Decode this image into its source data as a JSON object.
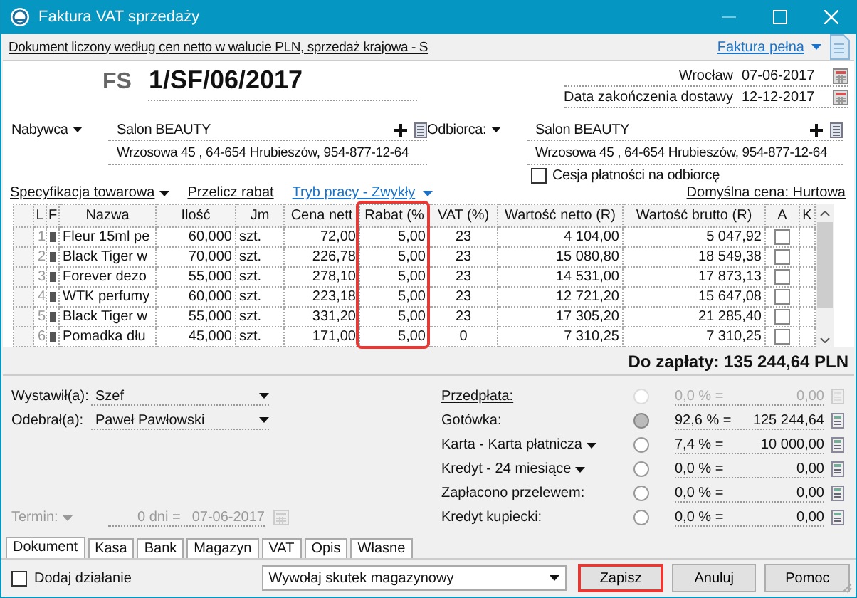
{
  "window": {
    "title": "Faktura VAT sprzedaży"
  },
  "info_bar": {
    "text": "Dokument liczony według cen netto w walucie PLN, sprzedaż krajowa - S",
    "invoice_type": "Faktura pełna"
  },
  "document": {
    "prefix": "FS",
    "number": "1/SF/06/2017",
    "place": "Wrocław",
    "issue_date": "07-06-2017",
    "delivery_label": "Data zakończenia dostawy",
    "delivery_date": "12-12-2017"
  },
  "buyer": {
    "label": "Nabywca",
    "name": "Salon BEAUTY",
    "address": "Wrzosowa  45 , 64-654 Hrubieszów, 954-877-12-64"
  },
  "recipient": {
    "label": "Odbiorca:",
    "name": "Salon BEAUTY",
    "address": "Wrzosowa  45 , 64-654 Hrubieszów, 954-877-12-64"
  },
  "cession": {
    "label": "Cesja płatności na odbiorcę",
    "checked": false
  },
  "toolbar": {
    "specification": "Specyfikacja towarowa",
    "recalculate": "Przelicz rabat",
    "mode": "Tryb pracy - Zwykły",
    "default_price": "Domyślna cena: Hurtowa"
  },
  "table": {
    "columns": [
      {
        "label": "L",
        "highlighted": false
      },
      {
        "label": "F",
        "highlighted": false
      },
      {
        "label": "Nazwa",
        "highlighted": false
      },
      {
        "label": "Ilość",
        "highlighted": false
      },
      {
        "label": "Jm",
        "highlighted": false
      },
      {
        "label": "Cena nett",
        "highlighted": false
      },
      {
        "label": "Rabat (%",
        "highlighted": true
      },
      {
        "label": "VAT (%)",
        "highlighted": false
      },
      {
        "label": "Wartość netto (R)",
        "highlighted": false
      },
      {
        "label": "Wartość brutto (R)",
        "highlighted": false
      },
      {
        "label": "A",
        "highlighted": false
      },
      {
        "label": "K",
        "highlighted": false
      }
    ],
    "rows": [
      {
        "lp": "1",
        "name": "Fleur 15ml pe",
        "quantity": "60,000",
        "unit": "szt.",
        "price": "72,00",
        "discount": "5,00",
        "vat": "23",
        "net": "4 104,00",
        "gross": "5 047,92",
        "a": false
      },
      {
        "lp": "2",
        "name": "Black Tiger w",
        "quantity": "70,000",
        "unit": "szt.",
        "price": "226,78",
        "discount": "5,00",
        "vat": "23",
        "net": "15 080,80",
        "gross": "18 549,38",
        "a": false
      },
      {
        "lp": "3",
        "name": "Forever dezo",
        "quantity": "55,000",
        "unit": "szt.",
        "price": "278,10",
        "discount": "5,00",
        "vat": "23",
        "net": "14 531,00",
        "gross": "17 873,13",
        "a": false
      },
      {
        "lp": "4",
        "name": "WTK perfumy",
        "quantity": "60,000",
        "unit": "szt.",
        "price": "223,18",
        "discount": "5,00",
        "vat": "23",
        "net": "12 721,20",
        "gross": "15 647,08",
        "a": false
      },
      {
        "lp": "5",
        "name": "Black Tiger w",
        "quantity": "55,000",
        "unit": "szt.",
        "price": "331,20",
        "discount": "5,00",
        "vat": "23",
        "net": "17 305,20",
        "gross": "21 285,40",
        "a": false
      },
      {
        "lp": "6",
        "name": "Pomadka dłu",
        "quantity": "45,000",
        "unit": "szt.",
        "price": "171,00",
        "discount": "5,00",
        "vat": "0",
        "net": "7 310,25",
        "gross": "7 310,25",
        "a": false
      }
    ]
  },
  "total": "Do zapłaty: 135 244,64 PLN",
  "issued_by": {
    "label": "Wystawił(a):",
    "value": "Szef"
  },
  "received_by": {
    "label": "Odebrał(a):",
    "value": "Paweł Pawłowski"
  },
  "term": {
    "label": "Termin:",
    "days": "0 dni =",
    "date": "07-06-2017",
    "disabled": true
  },
  "payments": [
    {
      "label": "Przedpłata:",
      "kind": "link",
      "percent": "0,0 % =",
      "amount": "0,00",
      "selected": false,
      "disabled": true
    },
    {
      "label": "Gotówka:",
      "kind": "plain",
      "percent": "92,6 % =",
      "amount": "125 244,64",
      "selected": true,
      "disabled": false
    },
    {
      "label": "Karta - Karta płatnicza",
      "kind": "dropdown",
      "percent": "7,4 % =",
      "amount": "10 000,00",
      "selected": false,
      "disabled": false
    },
    {
      "label": "Kredyt - 24 miesiące",
      "kind": "dropdown",
      "percent": "0,0 % =",
      "amount": "0,00",
      "selected": false,
      "disabled": false
    },
    {
      "label": "Zapłacono przelewem:",
      "kind": "plain",
      "percent": "0,0 % =",
      "amount": "0,00",
      "selected": false,
      "disabled": false
    },
    {
      "label": "Kredyt kupiecki:",
      "kind": "plain",
      "percent": "0,0 % =",
      "amount": "0,00",
      "selected": false,
      "disabled": false
    }
  ],
  "tabs": [
    {
      "label": "Dokument",
      "selected": true
    },
    {
      "label": "Kasa",
      "selected": false
    },
    {
      "label": "Bank",
      "selected": false
    },
    {
      "label": "Magazyn",
      "selected": false
    },
    {
      "label": "VAT",
      "selected": false
    },
    {
      "label": "Opis",
      "selected": false
    },
    {
      "label": "Własne",
      "selected": false
    }
  ],
  "add_action": {
    "label": "Dodaj działanie",
    "checked": false
  },
  "action_select": {
    "value": "Wywołaj skutek magazynowy"
  },
  "buttons": [
    {
      "label": "Zapisz",
      "highlighted": true
    },
    {
      "label": "Anuluj",
      "highlighted": false
    },
    {
      "label": "Pomoc",
      "highlighted": false
    }
  ]
}
